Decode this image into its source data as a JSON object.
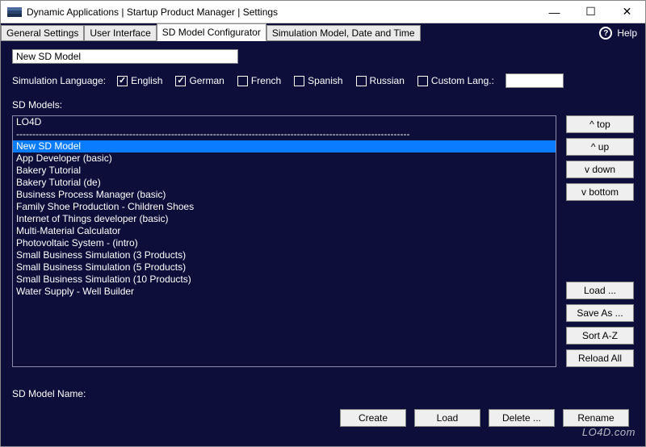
{
  "window": {
    "title": "Dynamic Applications | Startup Product Manager | Settings",
    "controls": {
      "minimize": "—",
      "maximize": "☐",
      "close": "✕"
    }
  },
  "tabs": {
    "items": [
      {
        "label": "General Settings",
        "active": false
      },
      {
        "label": "User Interface",
        "active": false
      },
      {
        "label": "SD Model Configurator",
        "active": true
      },
      {
        "label": "Simulation Model, Date and Time",
        "active": false
      }
    ],
    "help": "Help"
  },
  "model_name_input": {
    "value": "New SD Model"
  },
  "languages": {
    "label": "Simulation Language:",
    "items": [
      {
        "label": "English",
        "checked": true
      },
      {
        "label": "German",
        "checked": true
      },
      {
        "label": "French",
        "checked": false
      },
      {
        "label": "Spanish",
        "checked": false
      },
      {
        "label": "Russian",
        "checked": false
      },
      {
        "label": "Custom Lang.:",
        "checked": false
      }
    ],
    "custom_value": ""
  },
  "sd_models": {
    "label": "SD Models:",
    "items": [
      {
        "label": "LO4D",
        "selected": false
      },
      {
        "label": "--------------------------------------------------------------------------------------------------------------------------",
        "selected": false,
        "rule": true
      },
      {
        "label": "New SD Model",
        "selected": true
      },
      {
        "label": "App Developer (basic)",
        "selected": false
      },
      {
        "label": "Bakery Tutorial",
        "selected": false
      },
      {
        "label": "Bakery Tutorial (de)",
        "selected": false
      },
      {
        "label": "Business Process Manager (basic)",
        "selected": false
      },
      {
        "label": "Family Shoe Production - Children Shoes",
        "selected": false
      },
      {
        "label": "Internet of Things developer (basic)",
        "selected": false
      },
      {
        "label": "Multi-Material Calculator",
        "selected": false
      },
      {
        "label": "Photovoltaic System - (intro)",
        "selected": false
      },
      {
        "label": "Small Business Simulation  (3 Products)",
        "selected": false
      },
      {
        "label": "Small Business Simulation  (5 Products)",
        "selected": false
      },
      {
        "label": "Small Business Simulation (10 Products)",
        "selected": false
      },
      {
        "label": "Water Supply - Well Builder",
        "selected": false
      }
    ]
  },
  "side_buttons": {
    "top": "^  top",
    "up": "^  up",
    "down": "v  down",
    "bottom": "v  bottom",
    "load": "Load ...",
    "save_as": "Save As ...",
    "sort": "Sort A-Z",
    "reload": "Reload All"
  },
  "sd_model_name_label": "SD Model Name:",
  "bottom_buttons": {
    "create": "Create",
    "load": "Load",
    "delete": "Delete ...",
    "rename": "Rename"
  },
  "watermark": "LO4D.com"
}
